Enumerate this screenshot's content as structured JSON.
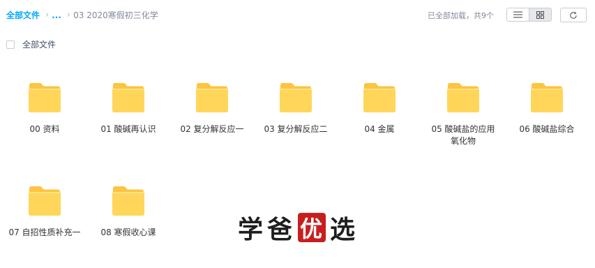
{
  "breadcrumb": {
    "root": "全部文件",
    "ellipsis": "...",
    "current": "03 2020寒假初三化学"
  },
  "status": {
    "loaded": "已全部加载，共9个"
  },
  "toolbar": {
    "list_view_icon": "list-icon",
    "grid_view_icon": "grid-icon",
    "refresh_icon": "refresh-icon",
    "active_view": "grid"
  },
  "select_all": {
    "label": "全部文件"
  },
  "folders": [
    {
      "name": "00 资料"
    },
    {
      "name": "01 酸碱再认识"
    },
    {
      "name": "02 复分解反应一"
    },
    {
      "name": "03 复分解反应二"
    },
    {
      "name": "04 金属"
    },
    {
      "name": "05 酸碱盐的应用 氧化物"
    },
    {
      "name": "06 酸碱盐综合"
    },
    {
      "name": "07 自招性质补充一"
    },
    {
      "name": "08 寒假收心课"
    }
  ],
  "watermark": {
    "chars": [
      "学",
      "爸",
      "优",
      "选"
    ]
  },
  "colors": {
    "accent": "#06a7ff",
    "folder_body": "#ffd65a",
    "folder_back": "#fcc440",
    "watermark_stamp": "#c81e1e"
  }
}
